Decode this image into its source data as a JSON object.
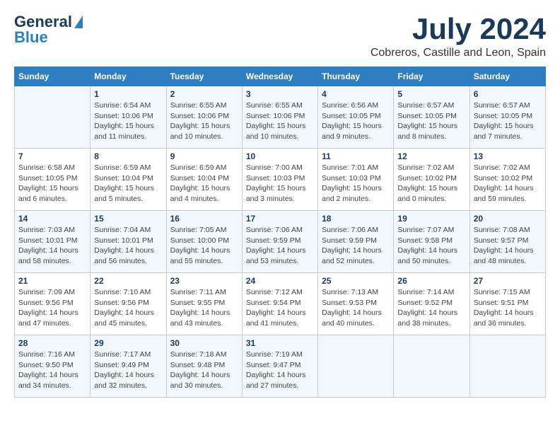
{
  "header": {
    "logo_general": "General",
    "logo_blue": "Blue",
    "month": "July 2024",
    "location": "Cobreros, Castille and Leon, Spain"
  },
  "weekdays": [
    "Sunday",
    "Monday",
    "Tuesday",
    "Wednesday",
    "Thursday",
    "Friday",
    "Saturday"
  ],
  "weeks": [
    [
      {
        "day": "",
        "info": ""
      },
      {
        "day": "1",
        "info": "Sunrise: 6:54 AM\nSunset: 10:06 PM\nDaylight: 15 hours\nand 11 minutes."
      },
      {
        "day": "2",
        "info": "Sunrise: 6:55 AM\nSunset: 10:06 PM\nDaylight: 15 hours\nand 10 minutes."
      },
      {
        "day": "3",
        "info": "Sunrise: 6:55 AM\nSunset: 10:06 PM\nDaylight: 15 hours\nand 10 minutes."
      },
      {
        "day": "4",
        "info": "Sunrise: 6:56 AM\nSunset: 10:05 PM\nDaylight: 15 hours\nand 9 minutes."
      },
      {
        "day": "5",
        "info": "Sunrise: 6:57 AM\nSunset: 10:05 PM\nDaylight: 15 hours\nand 8 minutes."
      },
      {
        "day": "6",
        "info": "Sunrise: 6:57 AM\nSunset: 10:05 PM\nDaylight: 15 hours\nand 7 minutes."
      }
    ],
    [
      {
        "day": "7",
        "info": "Sunrise: 6:58 AM\nSunset: 10:05 PM\nDaylight: 15 hours\nand 6 minutes."
      },
      {
        "day": "8",
        "info": "Sunrise: 6:59 AM\nSunset: 10:04 PM\nDaylight: 15 hours\nand 5 minutes."
      },
      {
        "day": "9",
        "info": "Sunrise: 6:59 AM\nSunset: 10:04 PM\nDaylight: 15 hours\nand 4 minutes."
      },
      {
        "day": "10",
        "info": "Sunrise: 7:00 AM\nSunset: 10:03 PM\nDaylight: 15 hours\nand 3 minutes."
      },
      {
        "day": "11",
        "info": "Sunrise: 7:01 AM\nSunset: 10:03 PM\nDaylight: 15 hours\nand 2 minutes."
      },
      {
        "day": "12",
        "info": "Sunrise: 7:02 AM\nSunset: 10:02 PM\nDaylight: 15 hours\nand 0 minutes."
      },
      {
        "day": "13",
        "info": "Sunrise: 7:02 AM\nSunset: 10:02 PM\nDaylight: 14 hours\nand 59 minutes."
      }
    ],
    [
      {
        "day": "14",
        "info": "Sunrise: 7:03 AM\nSunset: 10:01 PM\nDaylight: 14 hours\nand 58 minutes."
      },
      {
        "day": "15",
        "info": "Sunrise: 7:04 AM\nSunset: 10:01 PM\nDaylight: 14 hours\nand 56 minutes."
      },
      {
        "day": "16",
        "info": "Sunrise: 7:05 AM\nSunset: 10:00 PM\nDaylight: 14 hours\nand 55 minutes."
      },
      {
        "day": "17",
        "info": "Sunrise: 7:06 AM\nSunset: 9:59 PM\nDaylight: 14 hours\nand 53 minutes."
      },
      {
        "day": "18",
        "info": "Sunrise: 7:06 AM\nSunset: 9:59 PM\nDaylight: 14 hours\nand 52 minutes."
      },
      {
        "day": "19",
        "info": "Sunrise: 7:07 AM\nSunset: 9:58 PM\nDaylight: 14 hours\nand 50 minutes."
      },
      {
        "day": "20",
        "info": "Sunrise: 7:08 AM\nSunset: 9:57 PM\nDaylight: 14 hours\nand 48 minutes."
      }
    ],
    [
      {
        "day": "21",
        "info": "Sunrise: 7:09 AM\nSunset: 9:56 PM\nDaylight: 14 hours\nand 47 minutes."
      },
      {
        "day": "22",
        "info": "Sunrise: 7:10 AM\nSunset: 9:56 PM\nDaylight: 14 hours\nand 45 minutes."
      },
      {
        "day": "23",
        "info": "Sunrise: 7:11 AM\nSunset: 9:55 PM\nDaylight: 14 hours\nand 43 minutes."
      },
      {
        "day": "24",
        "info": "Sunrise: 7:12 AM\nSunset: 9:54 PM\nDaylight: 14 hours\nand 41 minutes."
      },
      {
        "day": "25",
        "info": "Sunrise: 7:13 AM\nSunset: 9:53 PM\nDaylight: 14 hours\nand 40 minutes."
      },
      {
        "day": "26",
        "info": "Sunrise: 7:14 AM\nSunset: 9:52 PM\nDaylight: 14 hours\nand 38 minutes."
      },
      {
        "day": "27",
        "info": "Sunrise: 7:15 AM\nSunset: 9:51 PM\nDaylight: 14 hours\nand 36 minutes."
      }
    ],
    [
      {
        "day": "28",
        "info": "Sunrise: 7:16 AM\nSunset: 9:50 PM\nDaylight: 14 hours\nand 34 minutes."
      },
      {
        "day": "29",
        "info": "Sunrise: 7:17 AM\nSunset: 9:49 PM\nDaylight: 14 hours\nand 32 minutes."
      },
      {
        "day": "30",
        "info": "Sunrise: 7:18 AM\nSunset: 9:48 PM\nDaylight: 14 hours\nand 30 minutes."
      },
      {
        "day": "31",
        "info": "Sunrise: 7:19 AM\nSunset: 9:47 PM\nDaylight: 14 hours\nand 27 minutes."
      },
      {
        "day": "",
        "info": ""
      },
      {
        "day": "",
        "info": ""
      },
      {
        "day": "",
        "info": ""
      }
    ]
  ]
}
